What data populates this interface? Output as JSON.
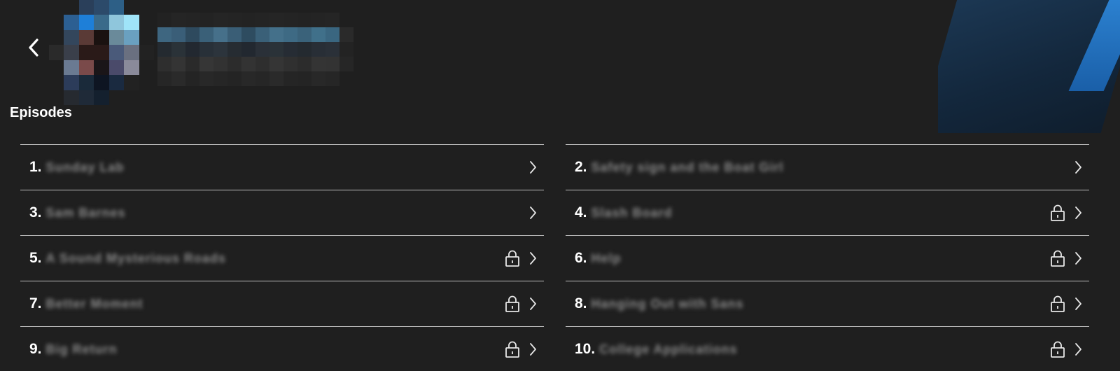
{
  "header": {
    "back_icon": "chevron-left-icon",
    "thumbnail_icon": "show-thumbnail-obscured"
  },
  "section": {
    "title": "Episodes"
  },
  "colors": {
    "background": "#1f1f1f",
    "divider": "#bdbdbd",
    "accent_blue": "#2e86d6"
  },
  "episodes": [
    {
      "number": "1.",
      "title": "Sunday Lab",
      "locked": false
    },
    {
      "number": "2.",
      "title": "Safety sign and the Boat Girl",
      "locked": false
    },
    {
      "number": "3.",
      "title": "Sam Barnes",
      "locked": false
    },
    {
      "number": "4.",
      "title": "Slash Board",
      "locked": true
    },
    {
      "number": "5.",
      "title": "A Sound Mysterious Roads",
      "locked": true
    },
    {
      "number": "6.",
      "title": "Help",
      "locked": true
    },
    {
      "number": "7.",
      "title": "Better Moment",
      "locked": true
    },
    {
      "number": "8.",
      "title": "Hanging Out with Sans",
      "locked": true
    },
    {
      "number": "9.",
      "title": "Big Return",
      "locked": true
    },
    {
      "number": "10.",
      "title": "College Applications",
      "locked": true
    }
  ]
}
